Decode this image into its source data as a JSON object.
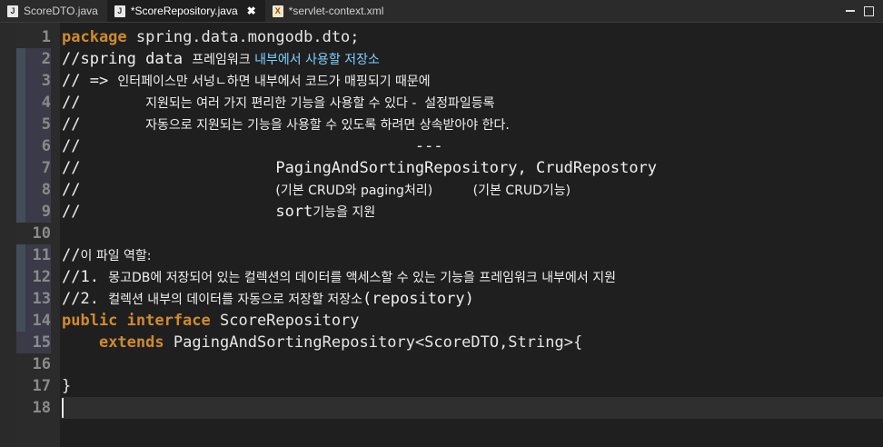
{
  "tabs": [
    {
      "label": "ScoreDTO.java",
      "icon": "java-file-icon",
      "active": false
    },
    {
      "label": "*ScoreRepository.java",
      "icon": "java-file-icon",
      "active": true,
      "close": "✖"
    },
    {
      "label": "*servlet-context.xml",
      "icon": "xml-file-icon",
      "active": false
    }
  ],
  "lines": [
    {
      "n": "1",
      "segs": [
        {
          "t": "package",
          "c": "kw"
        },
        {
          "t": " spring.data.mongodb.dto;",
          "c": "tx"
        }
      ]
    },
    {
      "n": "2",
      "segs": [
        {
          "t": "//spring data ",
          "c": "cm"
        },
        {
          "t": "프레임워크 ",
          "c": "cm kr"
        },
        {
          "t": "내부에서 사용할 저장소",
          "c": "hl kr"
        }
      ]
    },
    {
      "n": "3",
      "segs": [
        {
          "t": "// => ",
          "c": "cm"
        },
        {
          "t": "인터페이스만 서넝ㄴ하면 내부에서 코드가 매핑되기 때문에",
          "c": "cm kr"
        }
      ]
    },
    {
      "n": "4",
      "segs": [
        {
          "t": "//       ",
          "c": "cm"
        },
        {
          "t": "지원되는 여러 가지 편리한 기능을 사용할 수 있다 -  설정파일등록",
          "c": "cm kr"
        }
      ]
    },
    {
      "n": "5",
      "segs": [
        {
          "t": "//       ",
          "c": "cm"
        },
        {
          "t": "자동으로 지원되는 기능을 사용할 수 있도록 하려면 상속받아야 한다.",
          "c": "cm kr"
        }
      ]
    },
    {
      "n": "6",
      "segs": [
        {
          "t": "//                                    ---",
          "c": "cm"
        }
      ]
    },
    {
      "n": "7",
      "segs": [
        {
          "t": "//                     PagingAndSortingRepository, CrudRepostory",
          "c": "cm"
        }
      ]
    },
    {
      "n": "8",
      "segs": [
        {
          "t": "//                     ",
          "c": "cm"
        },
        {
          "t": "(기본 CRUD와 paging처리)          (기본 CRUD기능)",
          "c": "cm kr"
        }
      ]
    },
    {
      "n": "9",
      "segs": [
        {
          "t": "//                     ",
          "c": "cm"
        },
        {
          "t": "sort",
          "c": "cm"
        },
        {
          "t": "기능을 지원",
          "c": "cm kr"
        }
      ]
    },
    {
      "n": "10",
      "segs": []
    },
    {
      "n": "11",
      "segs": [
        {
          "t": "//",
          "c": "cm"
        },
        {
          "t": "이 파일 역할:",
          "c": "cm kr"
        }
      ]
    },
    {
      "n": "12",
      "segs": [
        {
          "t": "//1. ",
          "c": "cm"
        },
        {
          "t": "몽고DB에 저장되어 있는 컬렉션의 데이터를 액세스할 수 있는 기능을 프레임워크 내부에서 지원",
          "c": "cm kr"
        }
      ]
    },
    {
      "n": "13",
      "segs": [
        {
          "t": "//2. ",
          "c": "cm"
        },
        {
          "t": "컬렉션 내부의 데이터를 자동으로 저장할 저장소",
          "c": "cm kr"
        },
        {
          "t": "(repository)",
          "c": "cm"
        }
      ]
    },
    {
      "n": "14",
      "segs": [
        {
          "t": "public interface",
          "c": "kw"
        },
        {
          "t": " ScoreRepository",
          "c": "tx"
        }
      ]
    },
    {
      "n": "15",
      "segs": [
        {
          "t": "    ",
          "c": "tx"
        },
        {
          "t": "extends",
          "c": "kw"
        },
        {
          "t": " PagingAndSortingRepository<ScoreDTO,String>{",
          "c": "tx"
        }
      ]
    },
    {
      "n": "16",
      "segs": []
    },
    {
      "n": "17",
      "segs": [
        {
          "t": "}",
          "c": "tx"
        }
      ]
    },
    {
      "n": "18",
      "segs": []
    }
  ]
}
